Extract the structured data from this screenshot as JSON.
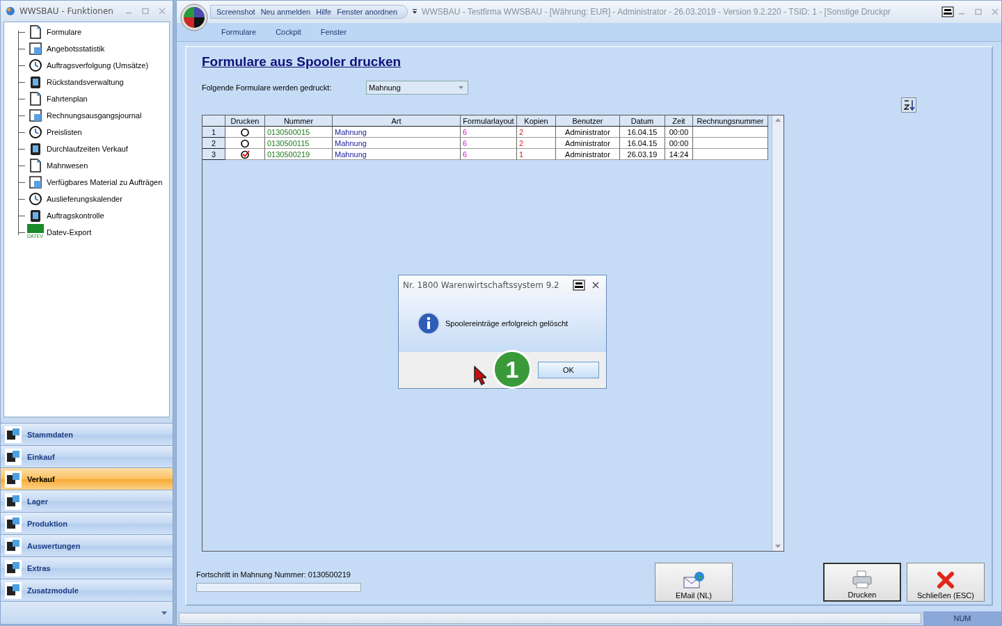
{
  "left_window": {
    "title": "WWSBAU - Funktionen",
    "tree_items": [
      {
        "label": "Formulare"
      },
      {
        "label": "Angebotsstatistik"
      },
      {
        "label": "Auftragsverfolgung (Umsätze)"
      },
      {
        "label": "Rückstandsverwaltung"
      },
      {
        "label": "Fahrtenplan"
      },
      {
        "label": "Rechnungsausgangsjournal"
      },
      {
        "label": "Preislisten"
      },
      {
        "label": "Durchlaufzeiten Verkauf"
      },
      {
        "label": "Mahnwesen"
      },
      {
        "label": "Verfügbares Material zu Aufträgen"
      },
      {
        "label": "Auslieferungskalender"
      },
      {
        "label": "Auftragskontrolle"
      },
      {
        "label": "Datev-Export",
        "icon_label": "DATEV"
      }
    ],
    "nav_sections": [
      {
        "label": "Stammdaten",
        "selected": false
      },
      {
        "label": "Einkauf",
        "selected": false
      },
      {
        "label": "Verkauf",
        "selected": true
      },
      {
        "label": "Lager",
        "selected": false
      },
      {
        "label": "Produktion",
        "selected": false
      },
      {
        "label": "Auswertungen",
        "selected": false
      },
      {
        "label": "Extras",
        "selected": false
      },
      {
        "label": "Zusatzmodule",
        "selected": false
      }
    ]
  },
  "main_window": {
    "title": "WWSBAU - Testfirma WWSBAU - [Währung: EUR] - Administrator - 26.03.2019 - Version 9.2.220 - TSID: 1  - [Sonstige Druckpr",
    "quick_access": [
      "Screenshot",
      "Neu anmelden",
      "Hilfe",
      "Fenster anordnen"
    ],
    "menu": [
      "Formulare",
      "Cockpit",
      "Fenster"
    ]
  },
  "page": {
    "heading": "Formulare aus Spooler drucken",
    "filter_label": "Folgende Formulare werden gedruckt:",
    "filter_value": "Mahnung",
    "table": {
      "columns": [
        "Drucken",
        "Nummer",
        "Art",
        "Formularlayout",
        "Kopien",
        "Benutzer",
        "Datum",
        "Zeit",
        "Rechnungsnummer"
      ],
      "rows": [
        {
          "index": "1",
          "checked": false,
          "nummer": "0130500015",
          "art": "Mahnung",
          "layout": "6",
          "kopien": "2",
          "benutzer": "Administrator",
          "datum": "16.04.15",
          "zeit": "00:00"
        },
        {
          "index": "2",
          "checked": false,
          "nummer": "0130500115",
          "art": "Mahnung",
          "layout": "6",
          "kopien": "2",
          "benutzer": "Administrator",
          "datum": "16.04.15",
          "zeit": "00:00"
        },
        {
          "index": "3",
          "checked": true,
          "nummer": "0130500219",
          "art": "Mahnung",
          "layout": "6",
          "kopien": "1",
          "benutzer": "Administrator",
          "datum": "26.03.19",
          "zeit": "14:24"
        }
      ]
    },
    "progress_label": "Fortschritt in Mahnung Nummer: 0130500219",
    "progress": {
      "level": 0
    },
    "buttons": [
      {
        "kind": "email",
        "label": "EMail (NL)"
      },
      {
        "kind": "print",
        "label": "Drucken"
      },
      {
        "kind": "close",
        "label": "Schließen (ESC)"
      }
    ]
  },
  "dialog": {
    "title": "Nr. 1800 Warenwirtschaftssystem 9.2",
    "message": "Spoolereinträge erfolgreich gelöscht",
    "button": "OK"
  },
  "annotation": "1",
  "status_bar": {
    "indicator": "NUM"
  }
}
